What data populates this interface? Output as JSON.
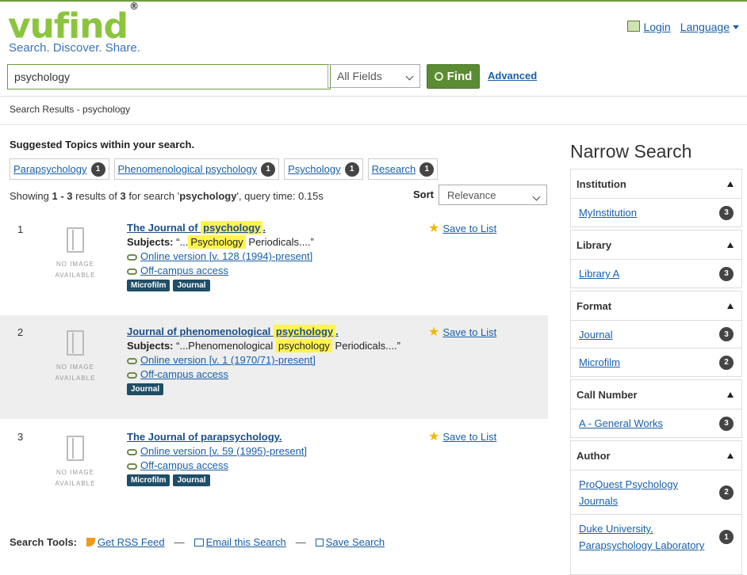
{
  "brand": {
    "logo_text": "vufind",
    "registered": "®",
    "tagline": "Search. Discover. Share."
  },
  "header": {
    "login_label": "Login",
    "language_label": "Language"
  },
  "search": {
    "query": "psychology",
    "type_selected": "All Fields",
    "find_label": "Find",
    "advanced_label": "Advanced"
  },
  "breadcrumb": "Search Results - psychology",
  "suggested": {
    "title": "Suggested Topics within your search.",
    "topics": [
      {
        "label": "Parapsychology",
        "count": "1"
      },
      {
        "label": "Phenomenological psychology",
        "count": "1"
      },
      {
        "label": "Psychology",
        "count": "1"
      },
      {
        "label": "Research",
        "count": "1"
      }
    ]
  },
  "summary": {
    "prefix": "Showing ",
    "range": "1 - 3",
    "mid": " results of ",
    "total": "3",
    "mid2": " for search '",
    "term": "psychology",
    "suffix": "', query time: 0.15s"
  },
  "sort": {
    "label": "Sort",
    "selected": "Relevance"
  },
  "no_image": [
    "NO IMAGE",
    "AVAILABLE"
  ],
  "results": [
    {
      "num": "1",
      "title_pre": "The Journal of ",
      "title_hl": "psychology",
      "title_post": ".",
      "subjects_label": "Subjects:",
      "subjects_pre": "“...",
      "subjects_hl": "Psychology",
      "subjects_post": " Periodicals....”",
      "online": "Online version [v. 128 (1994)-present]",
      "offcampus": "Off-campus access",
      "formats": [
        "Microfilm",
        "Journal"
      ],
      "save_label": "Save to List"
    },
    {
      "num": "2",
      "title_pre": "Journal of phenomenological ",
      "title_hl": "psychology",
      "title_post": ".",
      "subjects_label": "Subjects:",
      "subjects_pre": "“...Phenomenological ",
      "subjects_hl": "psychology",
      "subjects_post": " Periodicals....”",
      "online": "Online version [v. 1 (1970/71)-present]",
      "offcampus": "Off-campus access",
      "formats": [
        "Journal"
      ],
      "save_label": "Save to List"
    },
    {
      "num": "3",
      "title_pre": "The Journal of parapsychology.",
      "title_hl": "",
      "title_post": "",
      "online": "Online version [v. 59 (1995)-present]",
      "offcampus": "Off-campus access",
      "formats": [
        "Microfilm",
        "Journal"
      ],
      "save_label": "Save to List"
    }
  ],
  "tools": {
    "label": "Search Tools:",
    "rss": "Get RSS Feed",
    "email": "Email this Search",
    "save": "Save Search",
    "sep": "—"
  },
  "narrow": {
    "title": "Narrow Search",
    "facets": [
      {
        "name": "Institution",
        "items": [
          {
            "label": "MyInstitution",
            "count": "3"
          }
        ]
      },
      {
        "name": "Library",
        "items": [
          {
            "label": "Library A",
            "count": "3"
          }
        ]
      },
      {
        "name": "Format",
        "items": [
          {
            "label": "Journal",
            "count": "3"
          },
          {
            "label": "Microfilm",
            "count": "2"
          }
        ]
      },
      {
        "name": "Call Number",
        "items": [
          {
            "label": "A - General Works",
            "count": "3"
          }
        ]
      },
      {
        "name": "Author",
        "items": [
          {
            "label": "ProQuest Psychology Journals",
            "count": "2"
          },
          {
            "label": "Duke University. Parapsychology Laboratory",
            "count": "1"
          }
        ]
      }
    ]
  },
  "colors": {
    "brand_green": "#8bc53f",
    "button_green": "#5b8c33",
    "link": "#1a5fa8",
    "format_badge": "#1f4e66",
    "highlight": "#fff44f"
  }
}
